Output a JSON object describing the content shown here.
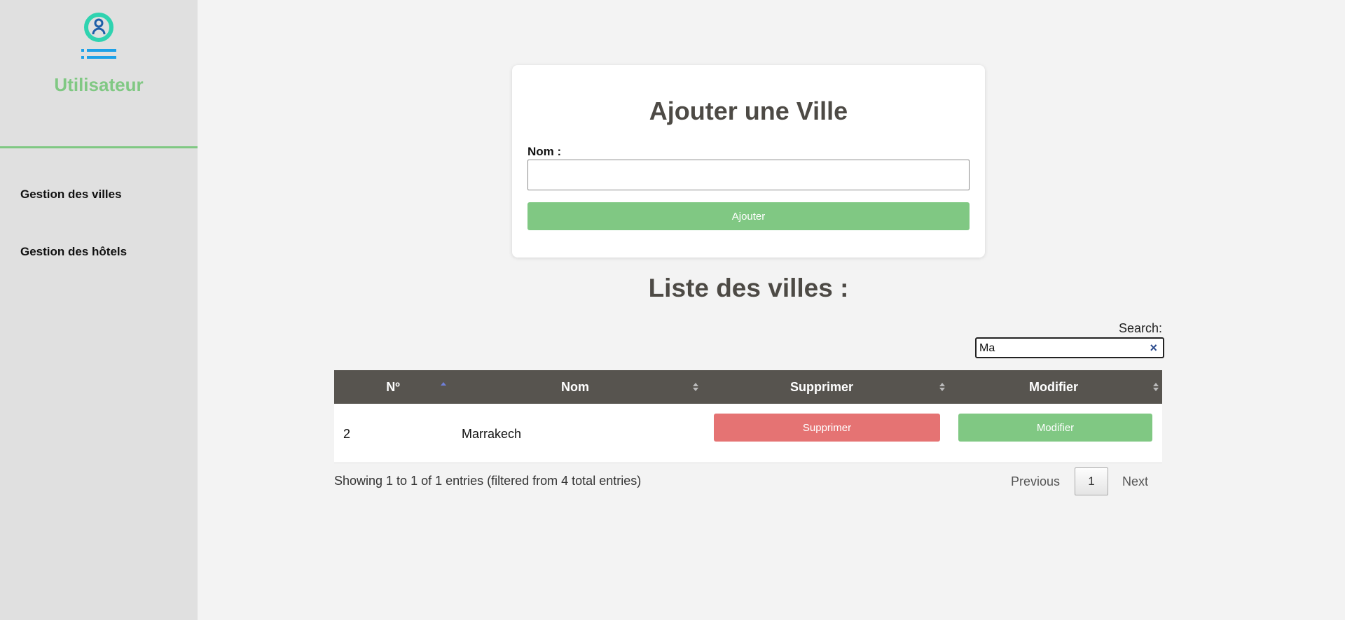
{
  "sidebar": {
    "brand": "Utilisateur",
    "logo_icon": "user-list-icon",
    "accent_color": "#80c883",
    "items": [
      {
        "label": "Gestion des villes"
      },
      {
        "label": "Gestion des hôtels"
      }
    ]
  },
  "form": {
    "title": "Ajouter une Ville",
    "name_label": "Nom :",
    "name_value": "",
    "submit_label": "Ajouter"
  },
  "list": {
    "title": "Liste des villes :",
    "search_label": "Search:",
    "search_value": "Ma",
    "columns": [
      "Nº",
      "Nom",
      "Supprimer",
      "Modifier"
    ],
    "sorted_column": "Nº",
    "sort_direction": "ascending",
    "rows": [
      {
        "num": "2",
        "nom": "Marrakech",
        "delete_label": "Supprimer",
        "edit_label": "Modifier"
      }
    ],
    "info": "Showing 1 to 1 of 1 entries (filtered from 4 total entries)",
    "pagination": {
      "previous": "Previous",
      "current_page": "1",
      "next": "Next"
    },
    "colors": {
      "header": "#57544f",
      "delete": "#e57373",
      "edit": "#80c883"
    }
  }
}
